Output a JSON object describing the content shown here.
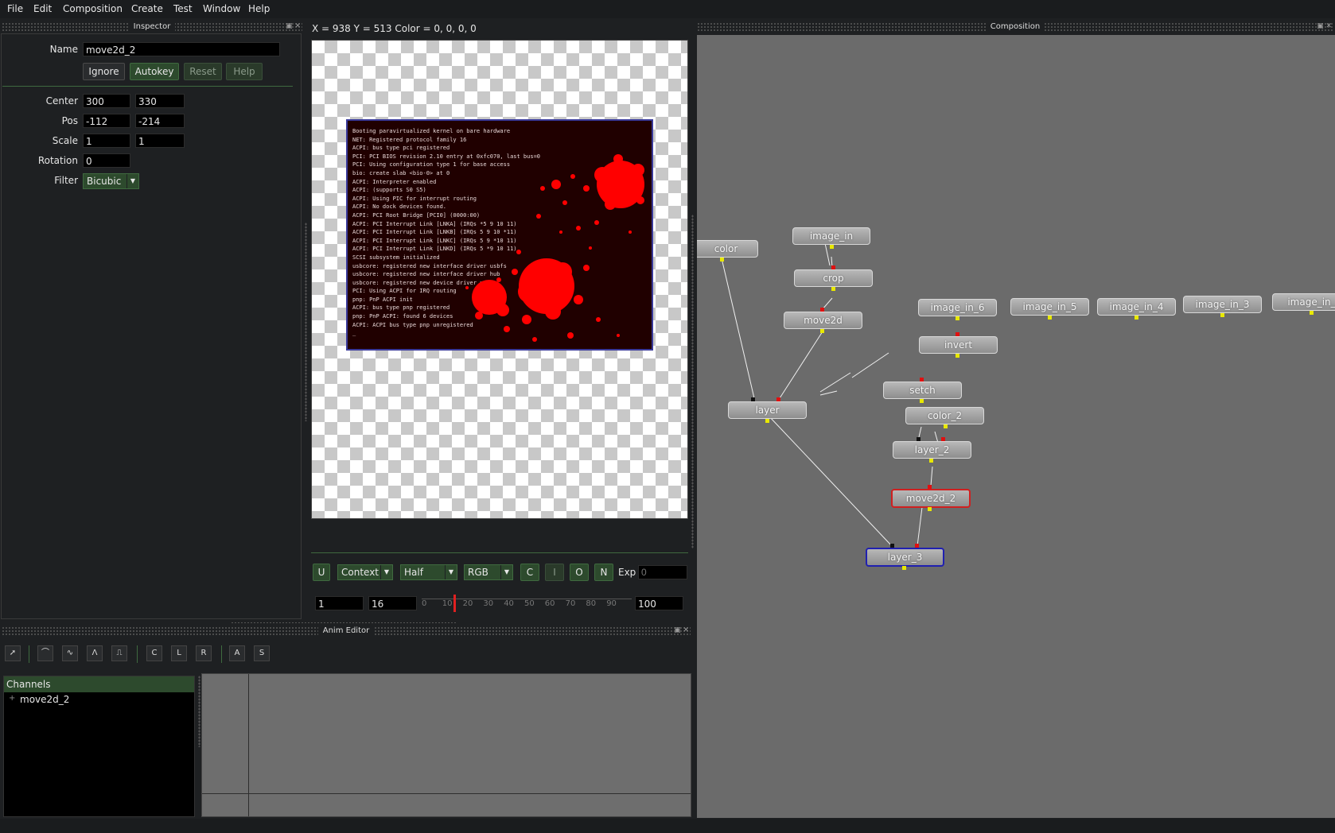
{
  "menu": [
    "File",
    "Edit",
    "Composition",
    "Create",
    "Test",
    "Window",
    "Help"
  ],
  "inspector": {
    "title": "Inspector",
    "name_label": "Name",
    "name_value": "move2d_2",
    "buttons": {
      "ignore": "Ignore",
      "autokey": "Autokey",
      "reset": "Reset",
      "help": "Help"
    },
    "center_label": "Center",
    "center_x": "300",
    "center_y": "330",
    "pos_label": "Pos",
    "pos_x": "-112",
    "pos_y": "-214",
    "scale_label": "Scale",
    "scale_x": "1",
    "scale_y": "1",
    "rotation_label": "Rotation",
    "rotation": "0",
    "filter_label": "Filter",
    "filter": "Bicubic"
  },
  "viewer": {
    "status": "X = 938 Y = 513 Color = 0, 0, 0, 0",
    "boot_log": [
      "Booting paravirtualized kernel on bare hardware",
      "NET: Registered protocol family 16",
      "ACPI: bus type pci registered",
      "PCI: PCI BIOS revision 2.10 entry at 0xfc070, last bus=0",
      "PCI: Using configuration type 1 for base access",
      "bio: create slab <bio-0> at 0",
      "ACPI: Interpreter enabled",
      "ACPI: (supports S0 S5)",
      "ACPI: Using PIC for interrupt routing",
      "ACPI: No dock devices found.",
      "ACPI: PCI Root Bridge [PCI0] (0000:00)",
      "ACPI: PCI Interrupt Link [LNKA] (IRQs *5 9 10 11)",
      "ACPI: PCI Interrupt Link [LNKB] (IRQs 5 9 10 *11)",
      "ACPI: PCI Interrupt Link [LNKC] (IRQs 5 9 *10 11)",
      "ACPI: PCI Interrupt Link [LNKD] (IRQs 5 *9 10 11)",
      "SCSI subsystem initialized",
      "usbcore: registered new interface driver usbfs",
      "usbcore: registered new interface driver hub",
      "usbcore: registered new device driver usb",
      "PCI: Using ACPI for IRQ routing",
      "pnp: PnP ACPI init",
      "ACPI: bus type pnp registered",
      "pnp: PnP ACPI: found 6 devices",
      "ACPI: ACPI bus type pnp unregistered",
      "_"
    ],
    "toolbar": {
      "u": "U",
      "context": "Context",
      "quality": "Half",
      "channels": "RGB",
      "c": "C",
      "i": "I",
      "o": "O",
      "n": "N",
      "exp_label": "Exp",
      "exp_placeholder": "0"
    },
    "timeline": {
      "start": "1",
      "current": "16",
      "end": "100",
      "ticks": [
        "0",
        "10",
        "20",
        "30",
        "40",
        "50",
        "60",
        "70",
        "80",
        "90"
      ]
    }
  },
  "anim_editor": {
    "title": "Anim Editor",
    "tools": {
      "c": "C",
      "l": "L",
      "r": "R",
      "a": "A",
      "s": "S"
    },
    "channels_header": "Channels",
    "channel_items": [
      {
        "expander": "+",
        "label": "move2d_2"
      }
    ]
  },
  "composition": {
    "title": "Composition",
    "nodes": {
      "color": "color",
      "image_in": "image_in",
      "crop": "crop",
      "move2d": "move2d",
      "layer": "layer",
      "image_in_6": "image_in_6",
      "image_in_5": "image_in_5",
      "image_in_4": "image_in_4",
      "image_in_3": "image_in_3",
      "image_in_x": "image_in_",
      "invert": "invert",
      "setch": "setch",
      "color_2": "color_2",
      "layer_2": "layer_2",
      "move2d_2": "move2d_2",
      "layer_3": "layer_3"
    }
  },
  "colors": {
    "accent_green": "#2d4a2d",
    "node_grey": "#a0a0a0",
    "selected_red": "#d02020",
    "selected_blue": "#2020b0",
    "splat_red": "#ff0000"
  }
}
